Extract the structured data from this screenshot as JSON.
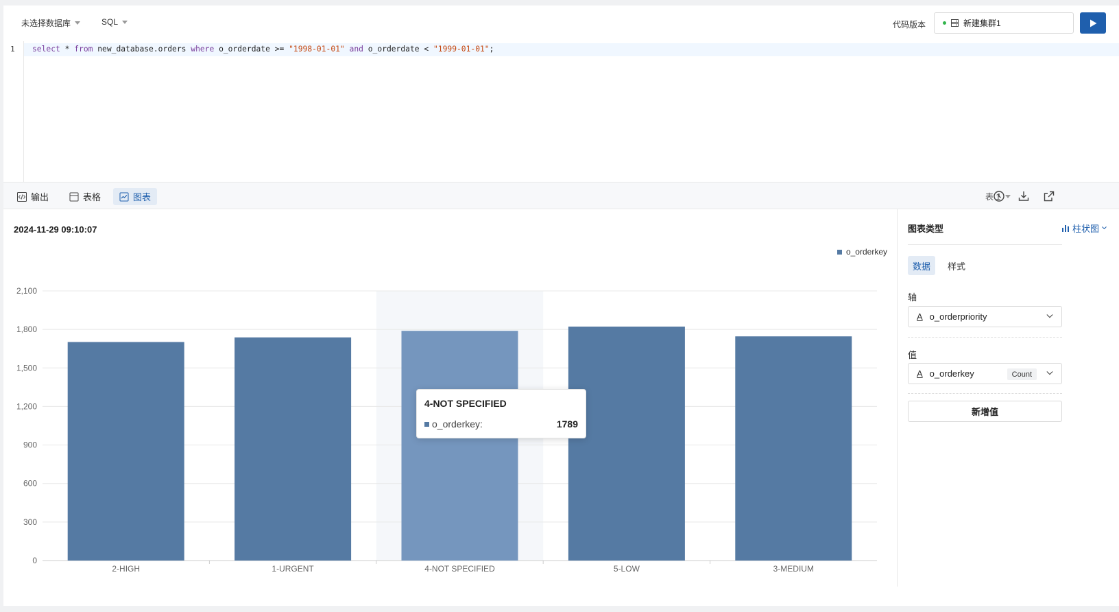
{
  "toolbar": {
    "database_select": "未选择数据库",
    "language_select": "SQL",
    "version_label": "代码版本",
    "cluster_name": "新建集群1",
    "run_icon": "play-icon"
  },
  "editor": {
    "line_number": "1",
    "code_tokens": [
      {
        "t": "select",
        "c": "kw"
      },
      {
        "t": " * ",
        "c": ""
      },
      {
        "t": "from",
        "c": "kw"
      },
      {
        "t": " new_database.orders ",
        "c": ""
      },
      {
        "t": "where",
        "c": "kw"
      },
      {
        "t": " o_orderdate >= ",
        "c": ""
      },
      {
        "t": "\"1998-01-01\"",
        "c": "str"
      },
      {
        "t": " ",
        "c": ""
      },
      {
        "t": "and",
        "c": "kw"
      },
      {
        "t": " o_orderdate < ",
        "c": ""
      },
      {
        "t": "\"1999-01-01\"",
        "c": "str"
      },
      {
        "t": ";",
        "c": ""
      }
    ]
  },
  "result_tabs": {
    "output": "输出",
    "table": "表格",
    "chart": "图表",
    "active": "chart",
    "table_select": "表 1"
  },
  "chart_view": {
    "timestamp": "2024-11-29 09:10:07"
  },
  "chart_data": {
    "type": "bar",
    "categories": [
      "2-HIGH",
      "1-URGENT",
      "4-NOT SPECIFIED",
      "5-LOW",
      "3-MEDIUM"
    ],
    "series": [
      {
        "name": "o_orderkey",
        "values": [
          1702,
          1738,
          1789,
          1822,
          1746
        ]
      }
    ],
    "yticks": [
      "0",
      "300",
      "600",
      "900",
      "1,200",
      "1,500",
      "1,800",
      "2,100"
    ],
    "ylim": [
      0,
      2100
    ],
    "grid": true,
    "legend_position": "top-right",
    "highlighted_category": "4-NOT SPECIFIED",
    "colors": {
      "bar": "#557aa3",
      "bar_highlight": "#7596be",
      "highlight_band": "#f5f7fa"
    }
  },
  "tooltip": {
    "title": "4-NOT SPECIFIED",
    "series_label": "o_orderkey:",
    "value": "1789"
  },
  "panel": {
    "title": "图表类型",
    "chart_type": "柱状图",
    "tab_data": "数据",
    "tab_style": "样式",
    "axis_label": "轴",
    "axis_field": "o_orderpriority",
    "value_label": "值",
    "value_field": "o_orderkey",
    "value_agg": "Count",
    "add_value": "新增值"
  },
  "colors": {
    "accent": "#1f5fad",
    "status_green": "#31b44b"
  }
}
